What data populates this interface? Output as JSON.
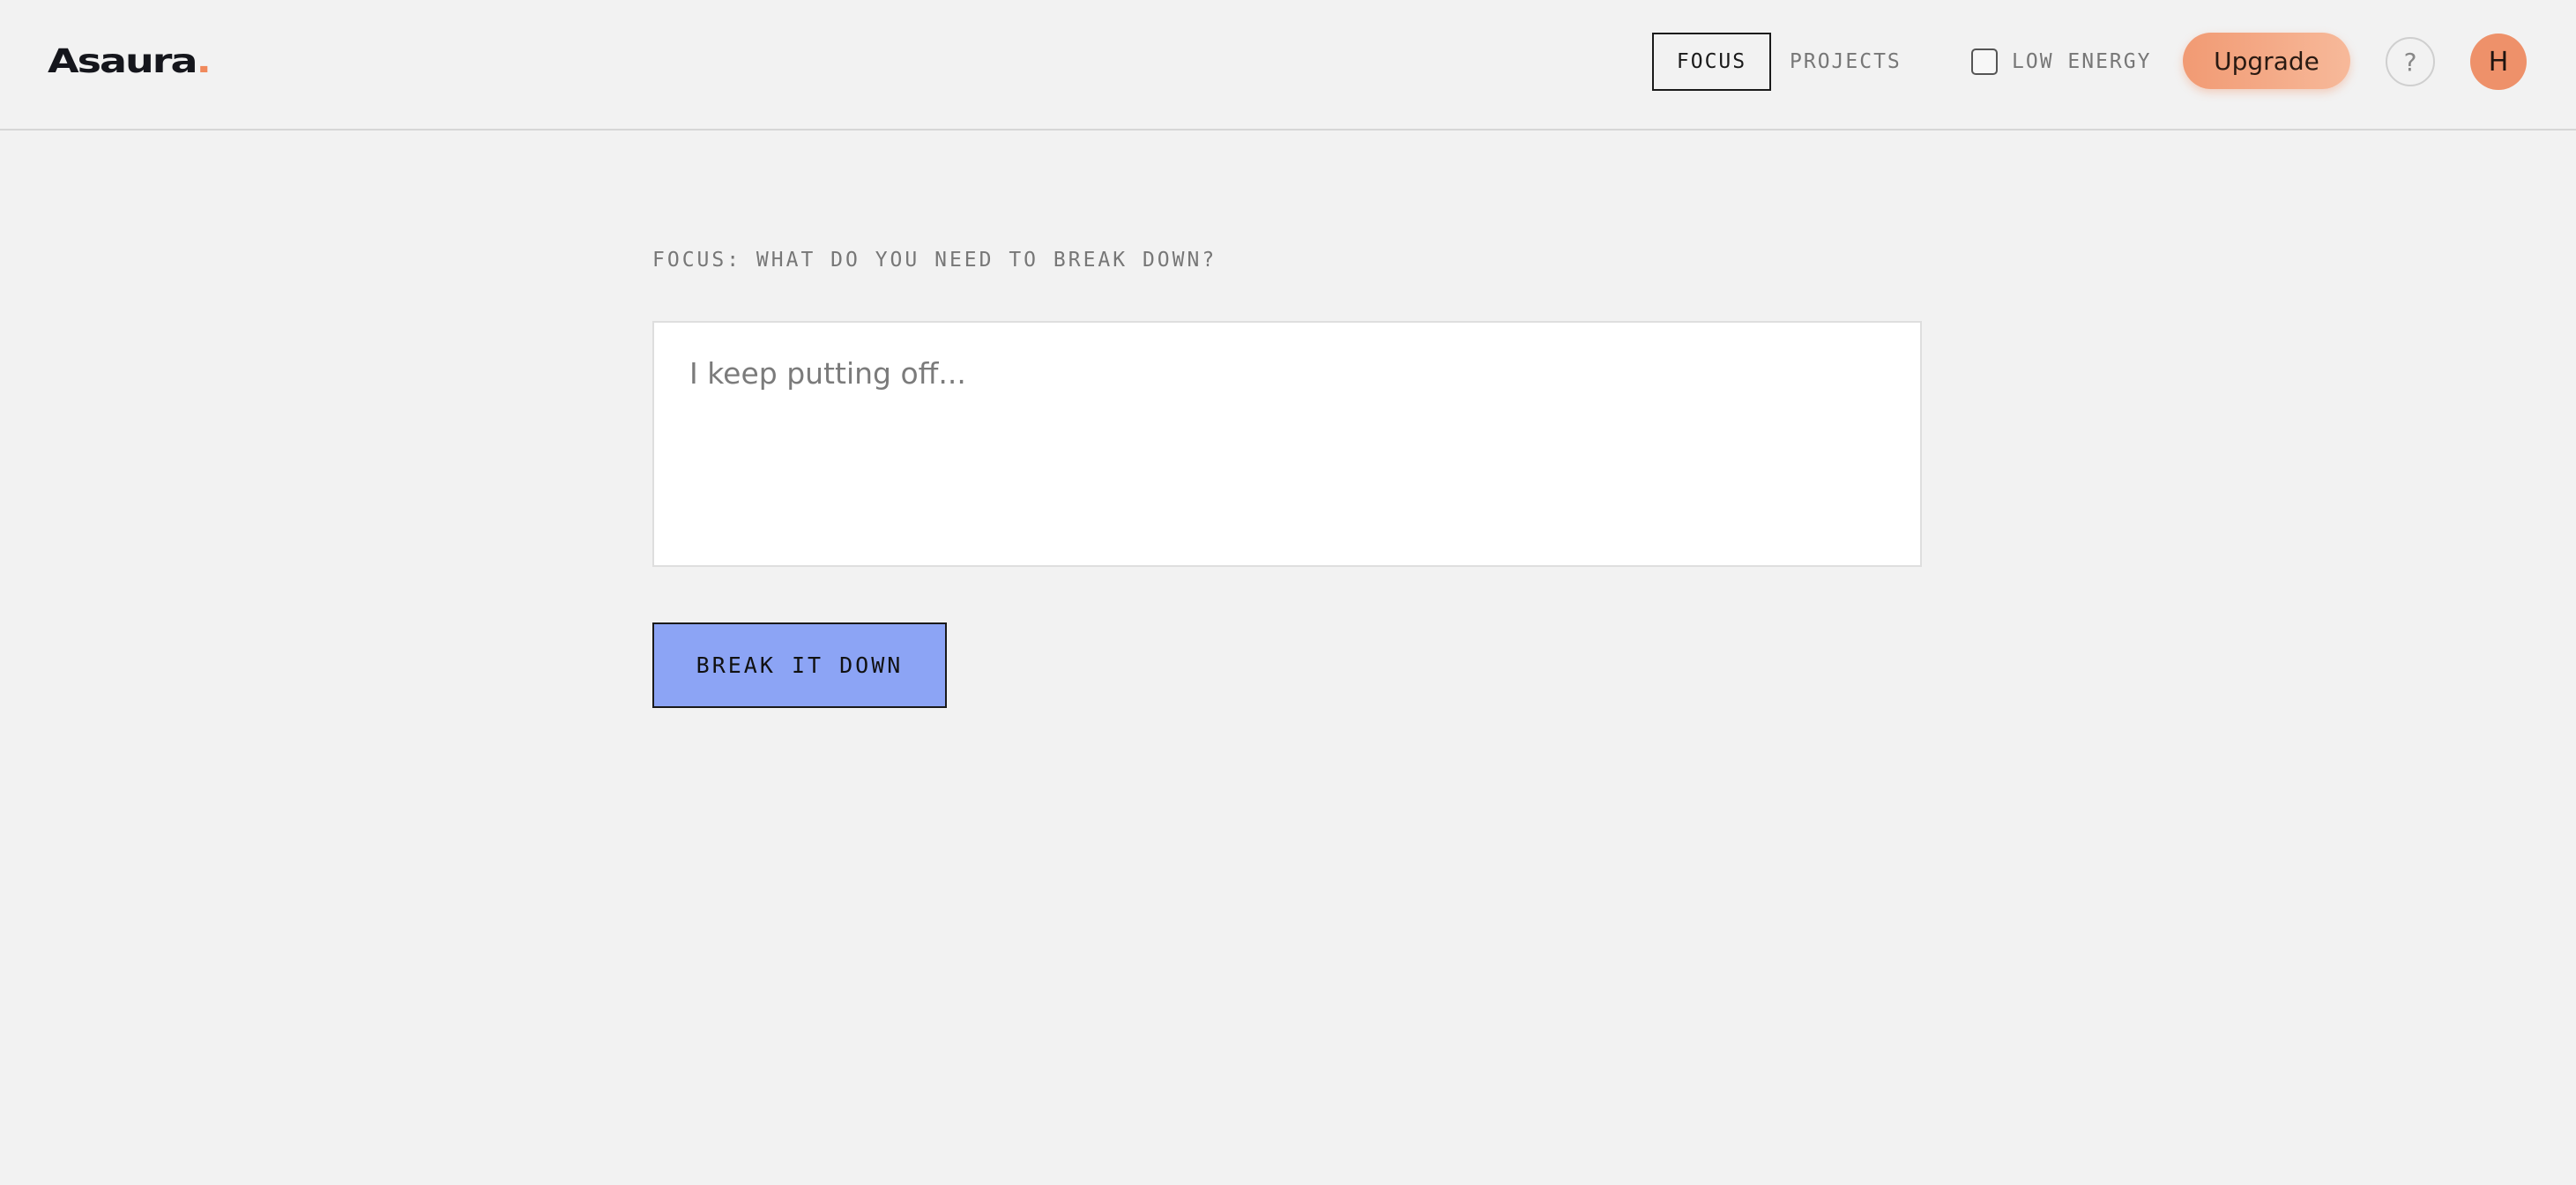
{
  "header": {
    "logo_text": "Asaura",
    "logo_dot": ".",
    "nav": {
      "focus_label": "FOCUS",
      "projects_label": "PROJECTS"
    },
    "low_energy_label": "LOW ENERGY",
    "low_energy_checked": false,
    "upgrade_label": "Upgrade",
    "help_label": "?",
    "avatar_initial": "H"
  },
  "main": {
    "prompt_label": "FOCUS: WHAT DO YOU NEED TO BREAK DOWN?",
    "input_placeholder": "I keep putting off...",
    "input_value": "",
    "submit_label": "BREAK IT DOWN"
  },
  "colors": {
    "accent_orange": "#f0895c",
    "button_blue": "#8ca4f5",
    "background": "#f2f2f2"
  },
  "icons": {
    "help": "question-mark-icon",
    "checkbox": "checkbox-icon"
  }
}
